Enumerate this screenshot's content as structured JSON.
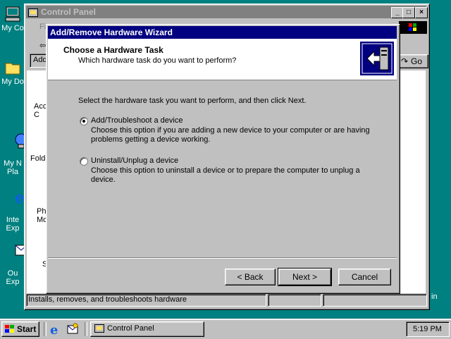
{
  "desktop": {
    "icons": [
      {
        "label": "My Co",
        "icon": "my-computer-icon"
      },
      {
        "label": "My Do",
        "icon": "my-documents-icon"
      },
      {
        "label": "My N\nPla",
        "icon": "network-places-icon"
      },
      {
        "label": "Inte\nExp",
        "icon": "internet-explorer-icon"
      },
      {
        "label": "Ou\nExp",
        "icon": "outlook-express-icon"
      }
    ]
  },
  "control_panel": {
    "title": "Control Panel",
    "menu_partial": "Fi",
    "address_partial": "Add",
    "go_label": "Go",
    "items_partial": [
      "Acc\nC",
      "Folde",
      "Ph\nMo",
      "S"
    ],
    "status_text": "Installs, removes, and troubleshoots hardware",
    "side_partial": "in"
  },
  "wizard": {
    "title": "Add/Remove Hardware Wizard",
    "heading": "Choose a Hardware Task",
    "subheading": "Which hardware task do you want to perform?",
    "instruction": "Select the hardware task you want to perform, and then click Next.",
    "options": [
      {
        "label": "Add/Troubleshoot a device",
        "description": "Choose this option if you are adding a new device to your computer or are having problems getting a device working.",
        "selected": true
      },
      {
        "label": "Uninstall/Unplug a device",
        "description": "Choose this option to uninstall a device or to prepare the computer to unplug a device.",
        "selected": false
      }
    ],
    "buttons": {
      "back": "< Back",
      "next": "Next >",
      "cancel": "Cancel"
    }
  },
  "taskbar": {
    "start_label": "Start",
    "task_button": "Control Panel",
    "clock": "5:19 PM"
  },
  "colors": {
    "desktop": "#008080",
    "title_active": "#000080",
    "title_inactive": "#808080",
    "face": "#c0c0c0"
  }
}
